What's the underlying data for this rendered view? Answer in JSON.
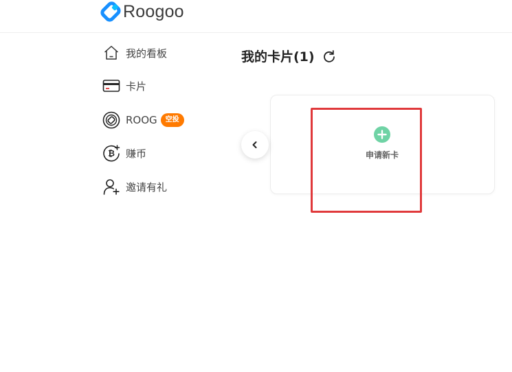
{
  "brand": {
    "name": "Roogoo",
    "mark_color": "#1890ff",
    "accent_color": "#0dbfff"
  },
  "sidebar": {
    "items": [
      {
        "label": "我的看板",
        "icon": "home-icon"
      },
      {
        "label": "卡片",
        "icon": "card-icon"
      },
      {
        "label": "ROOG",
        "icon": "roog-coin-icon",
        "badge": "空投"
      },
      {
        "label": "赚币",
        "icon": "bitcoin-icon"
      },
      {
        "label": "邀请有礼",
        "icon": "invite-user-icon"
      }
    ],
    "badge_color": "#ff7a00"
  },
  "main": {
    "title": "我的卡片(1)",
    "refresh_icon": "refresh-icon",
    "prev_icon": "chevron-left-icon",
    "apply_card": {
      "label": "申请新卡",
      "icon": "plus-circle-icon",
      "icon_color": "#6fd3a5"
    },
    "highlight_color": "#e0393b"
  }
}
